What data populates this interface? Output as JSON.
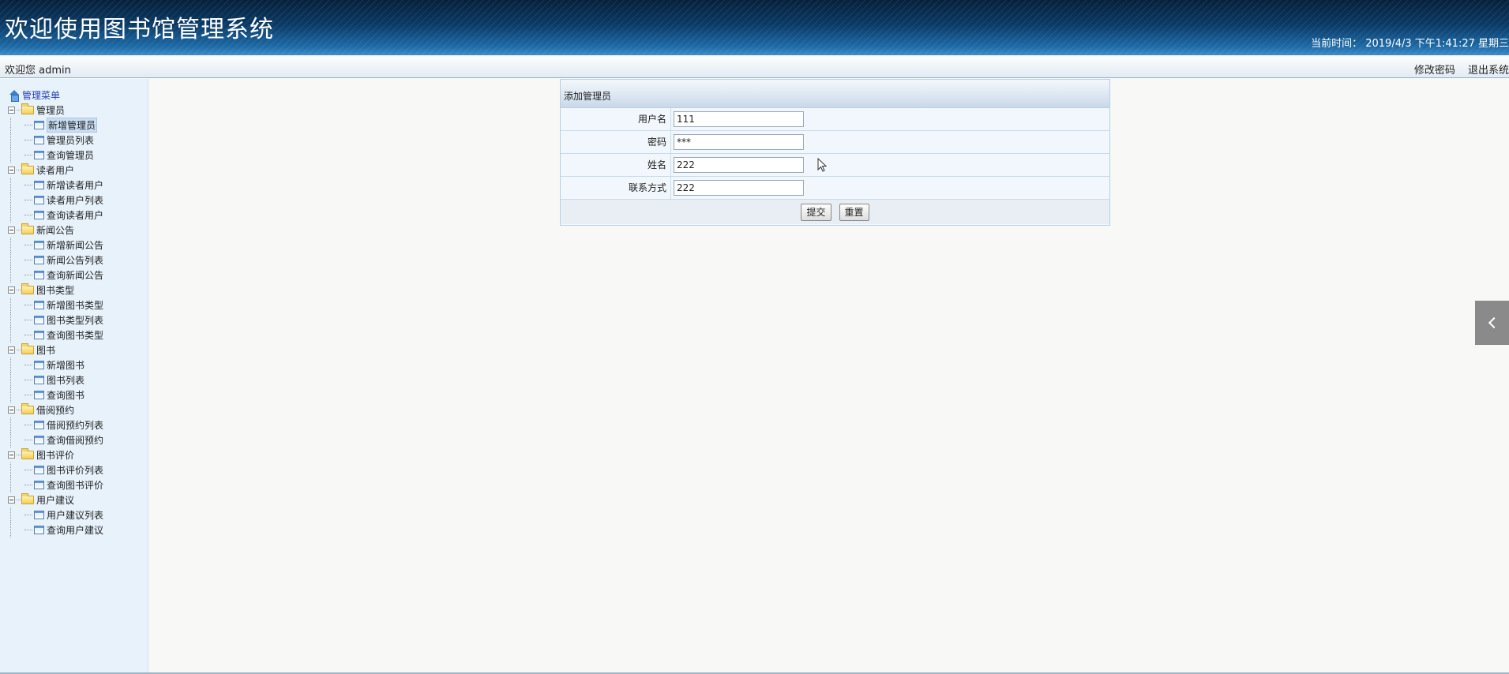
{
  "header": {
    "title": "欢迎使用图书馆管理系统",
    "time_label": "当前时间：",
    "time_value": "2019/4/3 下午1:41:27 星期三"
  },
  "topbar": {
    "welcome": "欢迎您 admin",
    "change_password": "修改密码",
    "logout": "退出系统"
  },
  "sidebar": {
    "root": "管理菜单",
    "groups": [
      {
        "label": "管理员",
        "items": [
          "新增管理员",
          "管理员列表",
          "查询管理员"
        ]
      },
      {
        "label": "读者用户",
        "items": [
          "新增读者用户",
          "读者用户列表",
          "查询读者用户"
        ]
      },
      {
        "label": "新闻公告",
        "items": [
          "新增新闻公告",
          "新闻公告列表",
          "查询新闻公告"
        ]
      },
      {
        "label": "图书类型",
        "items": [
          "新增图书类型",
          "图书类型列表",
          "查询图书类型"
        ]
      },
      {
        "label": "图书",
        "items": [
          "新增图书",
          "图书列表",
          "查询图书"
        ]
      },
      {
        "label": "借阅预约",
        "items": [
          "借阅预约列表",
          "查询借阅预约"
        ]
      },
      {
        "label": "图书评价",
        "items": [
          "图书评价列表",
          "查询图书评价"
        ]
      },
      {
        "label": "用户建议",
        "items": [
          "用户建议列表",
          "查询用户建议"
        ]
      }
    ],
    "selected": "新增管理员"
  },
  "form": {
    "title": "添加管理员",
    "fields": [
      {
        "label": "用户名",
        "value": "111",
        "type": "text"
      },
      {
        "label": "密码",
        "value": "***",
        "type": "password"
      },
      {
        "label": "姓名",
        "value": "222",
        "type": "text"
      },
      {
        "label": "联系方式",
        "value": "222",
        "type": "text"
      }
    ],
    "submit": "提交",
    "reset": "重置"
  },
  "icons": {
    "side_toggle": "chevron-left-icon"
  },
  "colors": {
    "banner": "#0a3a66",
    "sidebar_bg": "#e7f2fb",
    "form_bg": "#f1f7fc",
    "toggle_bg": "#8a8a8a"
  }
}
